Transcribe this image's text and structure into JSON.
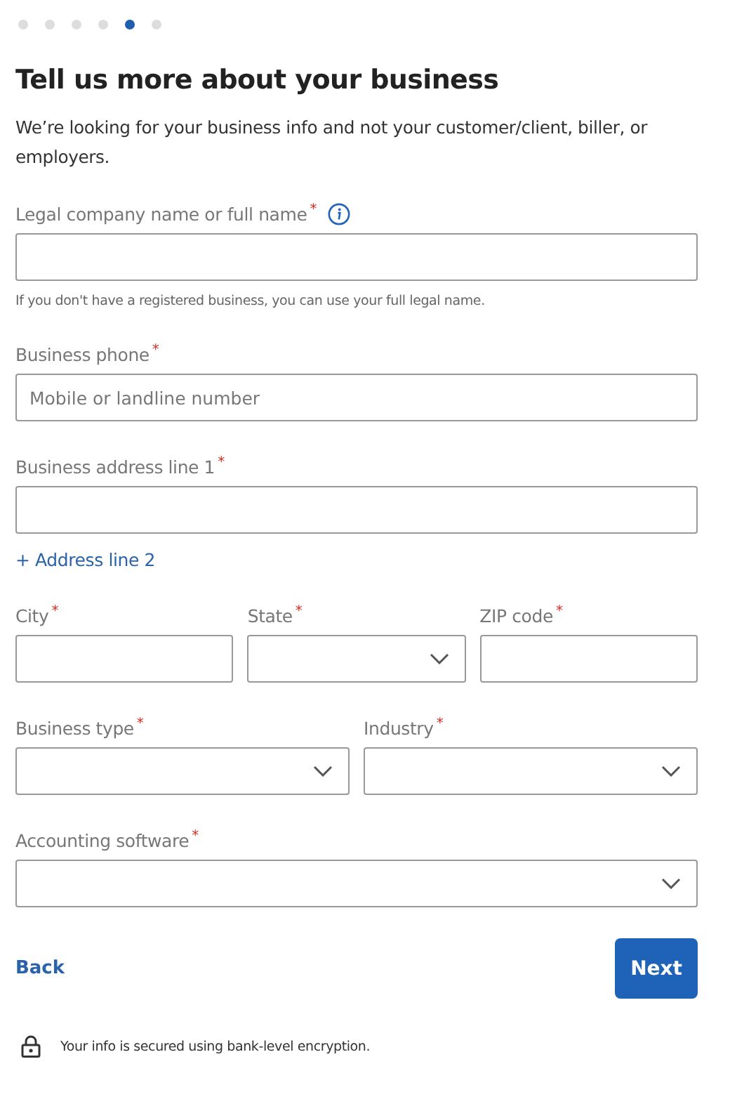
{
  "steps": [
    {
      "selected": false
    },
    {
      "selected": false
    },
    {
      "selected": false
    },
    {
      "selected": false
    },
    {
      "selected": true
    },
    {
      "selected": false
    }
  ],
  "title": "Tell us more about your business",
  "intro": "We’re looking for your business info and not your customer/client, biller, or employers.",
  "rows": [
    {
      "fields": [
        {
          "kind": "text",
          "label": "Legal company name or full name",
          "asterisk": "*",
          "info": true,
          "help": "If you don't have a registered business, you can use your full legal name."
        }
      ]
    },
    {
      "fields": [
        {
          "kind": "text",
          "label": "Business phone",
          "asterisk": "*",
          "placeholder": "Mobile or landline number"
        }
      ]
    },
    {
      "fields": [
        {
          "kind": "text",
          "label": "Business address line 1",
          "asterisk": "*"
        }
      ],
      "link": "+ Address line 2"
    },
    {
      "fields": [
        {
          "kind": "text",
          "label": "City",
          "asterisk": "*"
        },
        {
          "kind": "select",
          "label": "State",
          "asterisk": "*"
        },
        {
          "kind": "text",
          "label": "ZIP code",
          "asterisk": "*"
        }
      ]
    },
    {
      "fields": [
        {
          "kind": "select",
          "label": "Business type",
          "asterisk": "*"
        },
        {
          "kind": "select",
          "label": "Industry",
          "asterisk": "*"
        }
      ]
    },
    {
      "fields": [
        {
          "kind": "select",
          "label": "Accounting software",
          "asterisk": "*"
        }
      ]
    }
  ],
  "back": "Back",
  "next": "Next",
  "footer": "Your info is secured using bank-level encryption."
}
